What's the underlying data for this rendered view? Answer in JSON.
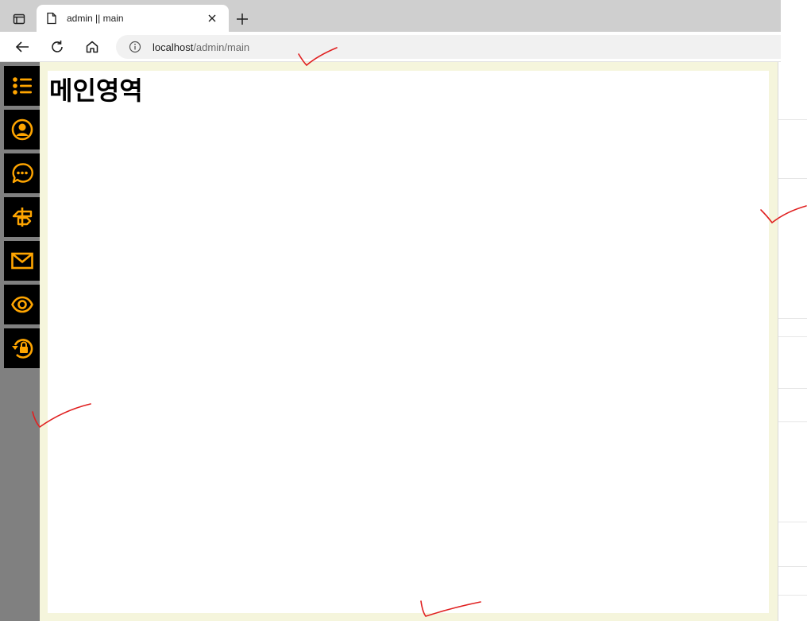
{
  "browser": {
    "tab_title": "admin || main",
    "url_host": "localhost",
    "url_path": "/admin/main"
  },
  "sidebar": {
    "items": [
      {
        "icon": "list-icon",
        "label": "list"
      },
      {
        "icon": "user-circle-icon",
        "label": "user"
      },
      {
        "icon": "chat-bubble-icon",
        "label": "chat"
      },
      {
        "icon": "signpost-icon",
        "label": "signpost"
      },
      {
        "icon": "mail-icon",
        "label": "mail"
      },
      {
        "icon": "eye-icon",
        "label": "view"
      },
      {
        "icon": "lock-reset-icon",
        "label": "lock-reset"
      }
    ]
  },
  "main": {
    "heading": "메인영역"
  },
  "colors": {
    "icon_accent": "#ffa500",
    "sidebar_bg": "#808080",
    "frame_bg": "#f5f5dc",
    "annotation": "#e02020"
  }
}
